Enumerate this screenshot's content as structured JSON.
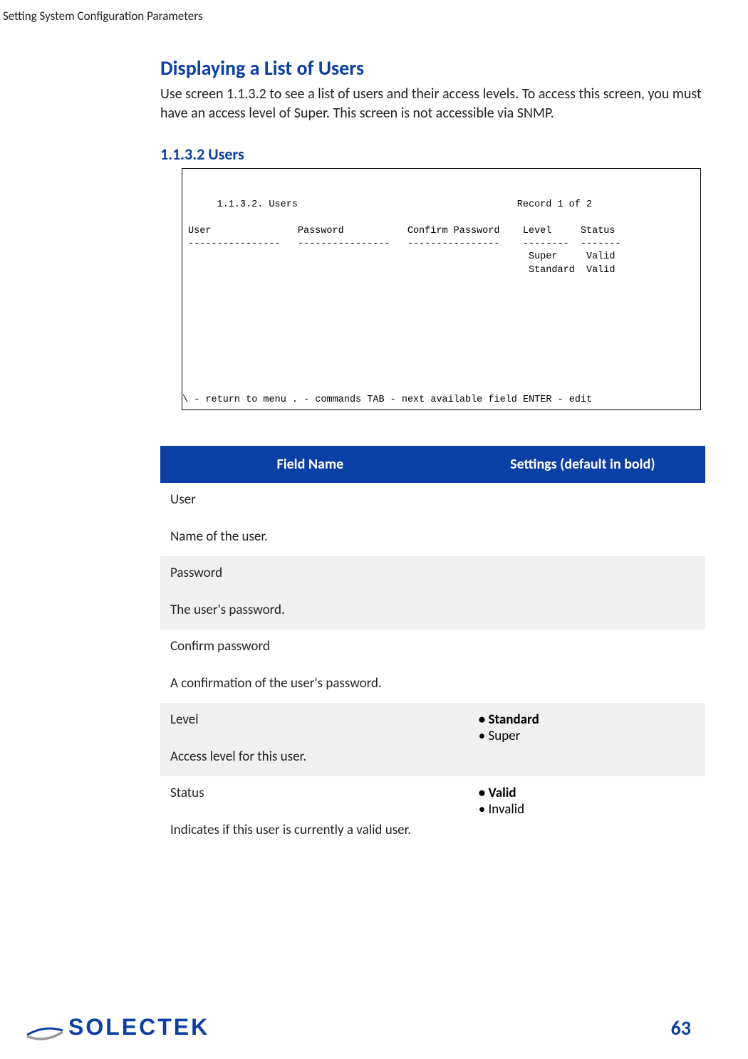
{
  "header": "Setting System Configuration Parameters",
  "title": "Displaying a List of Users",
  "intro": "Use screen 1.1.3.2 to see a list of users and their access levels. To access this screen, you must have an access level of Super. This screen is not accessible via SNMP.",
  "subtitle": "1.1.3.2 Users",
  "terminal": {
    "body": "     1.1.3.2. Users                                      Record 1 of 2\n\nUser               Password           Confirm Password    Level     Status\n----------------   ----------------   ----------------    --------  -------\n                                                           Super     Valid\n                                                           Standard  Valid",
    "footer": "\\ - return to menu    . - commands    TAB - next available field    ENTER - edit"
  },
  "table": {
    "col1": "Field Name",
    "col2": "Settings (default in bold)",
    "rows": [
      {
        "name": "User",
        "desc": "Name of the user."
      },
      {
        "name": "Password",
        "desc": "The user's password."
      },
      {
        "name": "Confirm password",
        "desc": "A confirmation of the user's password."
      },
      {
        "name": "Level",
        "desc": "Access level for this user.",
        "s1": "Standard",
        "s2": "Super"
      },
      {
        "name": "Status",
        "desc": "Indicates if this user is currently a valid user.",
        "s1": "Valid",
        "s2": "Invalid"
      }
    ]
  },
  "pageNum": "63",
  "logoText": "SOLECTEK"
}
